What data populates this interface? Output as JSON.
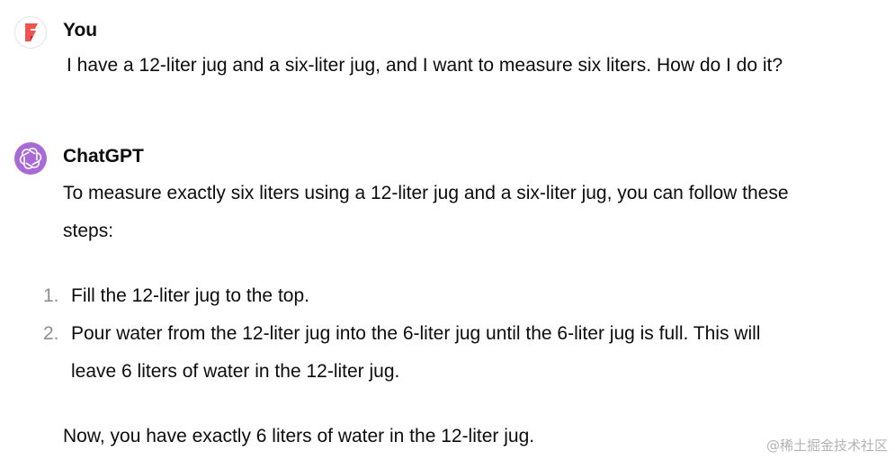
{
  "user_message": {
    "author": "You",
    "avatar_icon": "user-logo-icon",
    "avatar_color": "#ef5350",
    "text": "I have a 12-liter jug and a six-liter jug, and I want to measure six liters. How do I do it?"
  },
  "assistant_message": {
    "author": "ChatGPT",
    "avatar_icon": "openai-logo-icon",
    "avatar_color": "#a86bd6",
    "intro_line1": "To measure exactly six liters using a 12-liter jug and a six-liter jug, you can follow these",
    "intro_line2": "steps:",
    "steps": [
      {
        "number": "1.",
        "line1": "Fill the 12-liter jug to the top."
      },
      {
        "number": "2.",
        "line1": "Pour water from the 12-liter jug into the 6-liter jug until the 6-liter jug is full. This will",
        "line2": "leave 6 liters of water in the 12-liter jug."
      }
    ],
    "conclusion": "Now, you have exactly 6 liters of water in the 12-liter jug."
  },
  "watermark": "@稀土掘金技术社区"
}
